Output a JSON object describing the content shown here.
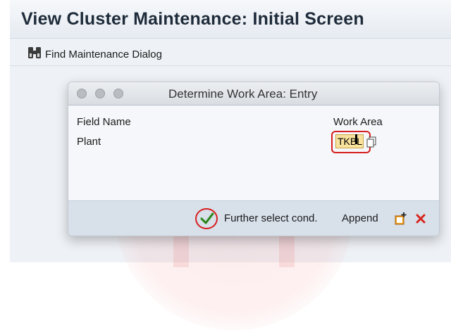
{
  "window": {
    "title": "View Cluster Maintenance: Initial Screen"
  },
  "toolbar": {
    "find_label": "Find Maintenance Dialog",
    "find_icon": "binoculars-icon"
  },
  "dialog": {
    "title": "Determine Work Area: Entry",
    "header_field": "Field Name",
    "header_value": "Work Area",
    "row_label": "Plant",
    "row_value": "TKBL",
    "footer": {
      "further_select_label": "Further select cond.",
      "append_label": "Append"
    }
  },
  "colors": {
    "highlight": "#d81f1f",
    "input_bg": "#f8e29c",
    "check": "#3a9a2a"
  }
}
